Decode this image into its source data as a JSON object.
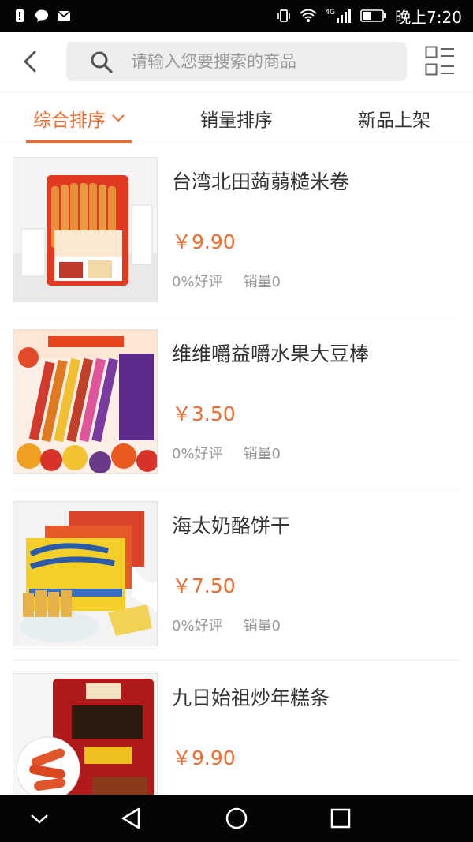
{
  "status_bar": {
    "time": "晚上7:20",
    "network": "4G"
  },
  "search": {
    "placeholder": "请输入您要搜索的商品"
  },
  "sort_tabs": [
    {
      "label": "综合排序",
      "active": true
    },
    {
      "label": "销量排序",
      "active": false
    },
    {
      "label": "新品上架",
      "active": false
    }
  ],
  "products": [
    {
      "name": "台湾北田蒟蒻糙米卷",
      "price": "￥9.90",
      "rating": "0%好评",
      "sales": "销量0"
    },
    {
      "name": "维维嚼益嚼水果大豆棒",
      "price": "￥3.50",
      "rating": "0%好评",
      "sales": "销量0"
    },
    {
      "name": "海太奶酪饼干",
      "price": "￥7.50",
      "rating": "0%好评",
      "sales": "销量0"
    },
    {
      "name": "九日始祖炒年糕条",
      "price": "￥9.90",
      "rating": "",
      "sales": ""
    }
  ],
  "colors": {
    "accent": "#f26a2e",
    "status_bar": "#050505",
    "search_bg": "#eeeeee"
  },
  "icons": [
    "back-arrow-icon",
    "search-icon",
    "layout-toggle-icon",
    "chevron-down-icon",
    "nav-back-icon",
    "nav-home-icon",
    "nav-recent-icon",
    "nav-down-icon"
  ]
}
